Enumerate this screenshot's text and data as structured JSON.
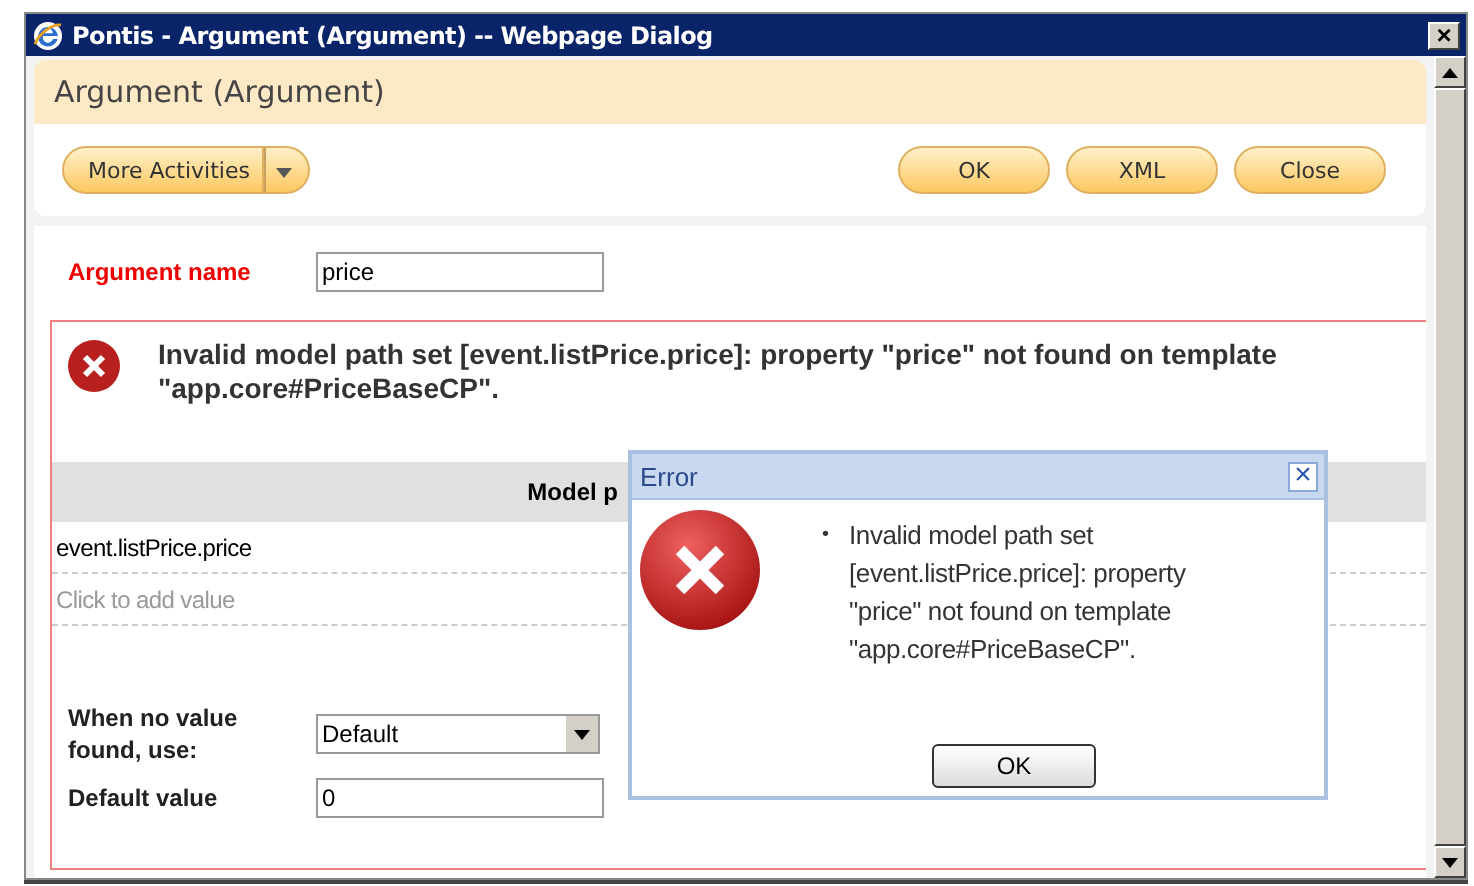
{
  "window": {
    "title": "Pontis - Argument (Argument) -- Webpage Dialog",
    "close": "×"
  },
  "header": {
    "title": "Argument (Argument)"
  },
  "toolbar": {
    "menu_button": "More Activities",
    "buttons": [
      "OK",
      "XML",
      "Close"
    ]
  },
  "form": {
    "argument_name": {
      "label": "Argument name",
      "value": "price"
    },
    "error_message": "Invalid model path set [event.listPrice.price]: property \"price\" not found on template \"app.core#PriceBaseCP\".",
    "table": {
      "column_header": "Model p",
      "rows": [
        {
          "value": "event.listPrice.price",
          "placeholder": false
        },
        {
          "value": "Click to add value",
          "placeholder": true
        }
      ]
    },
    "no_value": {
      "label": "When no value found, use:",
      "value": "Default"
    },
    "default_value": {
      "label": "Default value",
      "value": "0"
    }
  },
  "error_dialog": {
    "title": "Error",
    "close": "×",
    "bullet": "•",
    "messages": [
      "Invalid model path set [event.listPrice.price]: property \"price\" not found on template \"app.core#PriceBaseCP\"."
    ],
    "button": "OK"
  }
}
